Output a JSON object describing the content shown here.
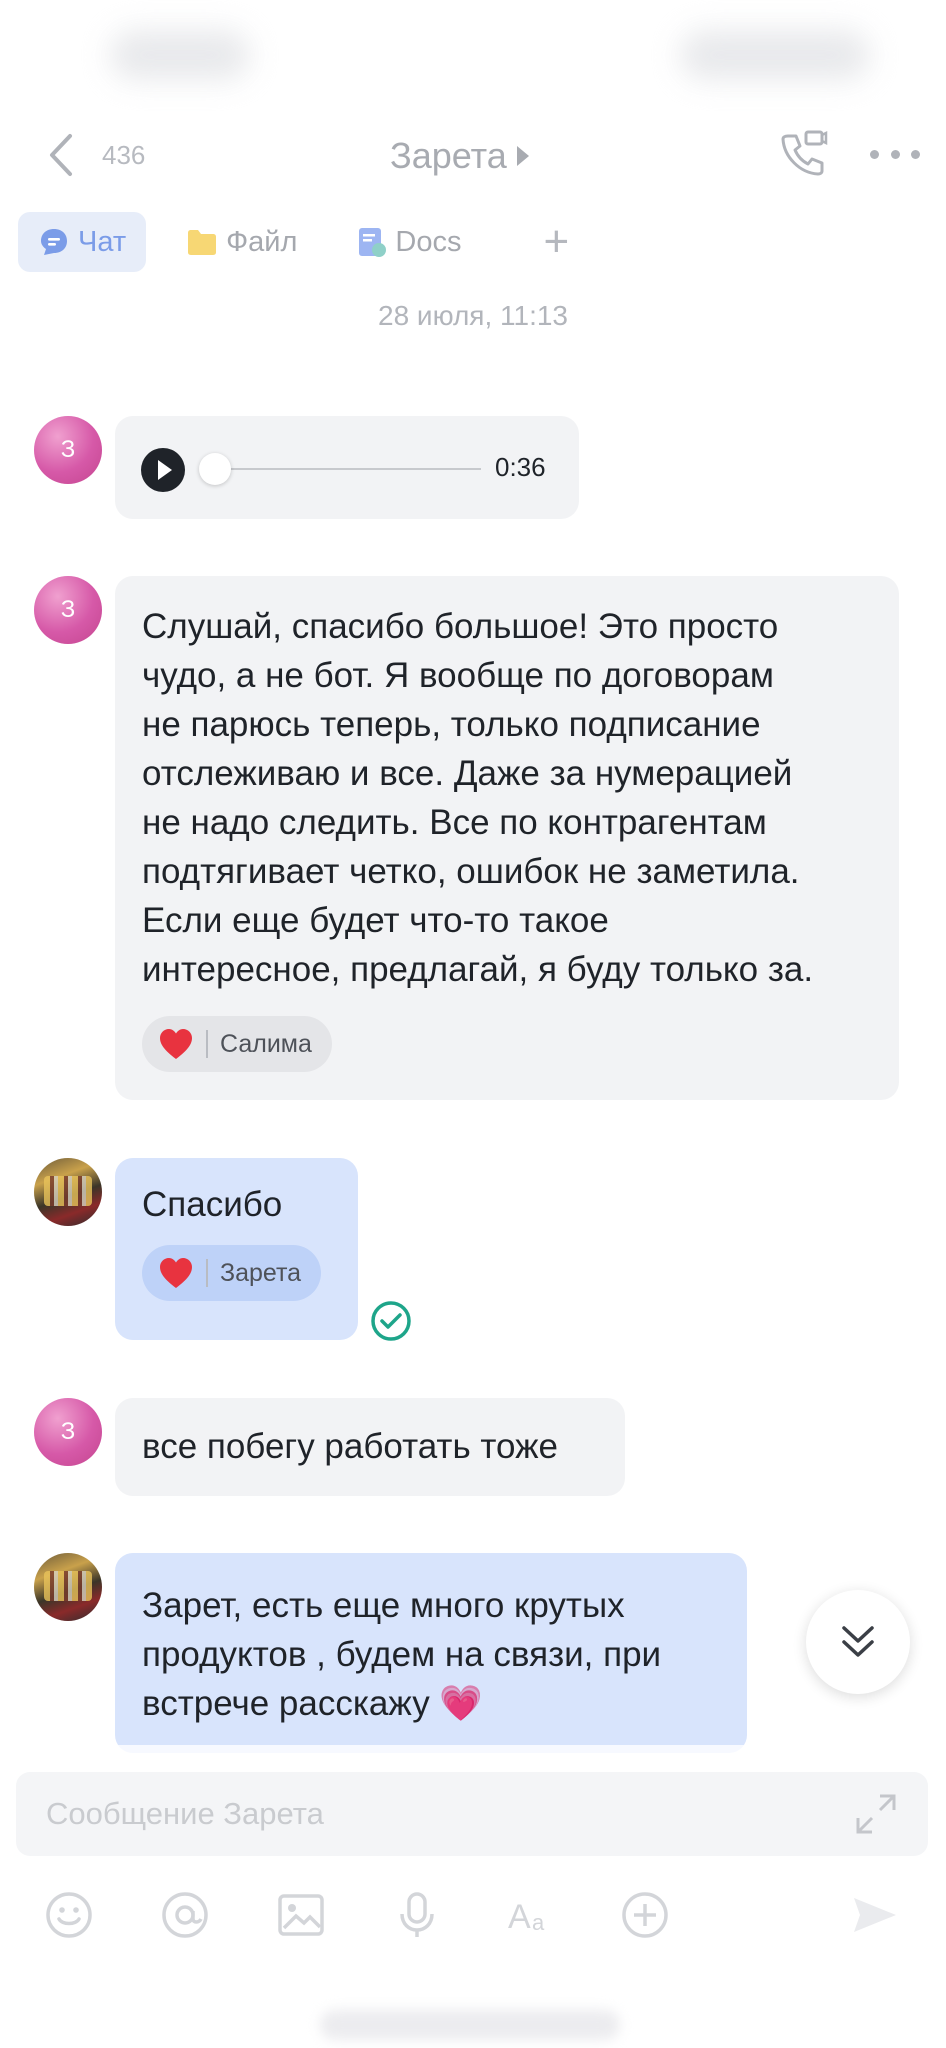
{
  "header": {
    "unread_count": "436",
    "title": "Зарета"
  },
  "tabs": [
    {
      "label": "Чат",
      "icon": "chat-bubble-icon",
      "active": true
    },
    {
      "label": "Файл",
      "icon": "folder-icon",
      "active": false
    },
    {
      "label": "Docs",
      "icon": "docs-icon",
      "active": false
    }
  ],
  "date_separator": "28 июля, 11:13",
  "messages": {
    "voice": {
      "avatar_letter": "З",
      "duration": "0:36"
    },
    "long": {
      "avatar_letter": "З",
      "lines": [
        "Слушай, спасибо большое! Это просто",
        "чудо, а не бот. Я вообще по договорам",
        "не парюсь теперь, только подписание",
        "отслеживаю и все. Даже за нумерацией",
        "не надо следить. Все по контрагентам",
        "подтягивает четко, ошибок не заметила.",
        "Если еще будет что-то такое",
        "интересное, предлагай, я буду только за."
      ],
      "reaction_user": "Салима"
    },
    "thanks": {
      "text": "Спасибо",
      "reaction_user": "Зарета"
    },
    "leaving": {
      "avatar_letter": "З",
      "text": "все побегу работать тоже"
    },
    "last": {
      "lines": [
        "Зарет, есть еще много крутых",
        "продуктов , будем на связи, при",
        "встрече расскажу 💗"
      ]
    }
  },
  "composer": {
    "placeholder": "Сообщение Зарета"
  },
  "colors": {
    "accent": "#7b9ce8",
    "my_bubble": "#d8e4fc",
    "other_bubble": "#f2f3f5",
    "avatar_pink": "#d659a8",
    "read_check": "#1ea58a"
  }
}
